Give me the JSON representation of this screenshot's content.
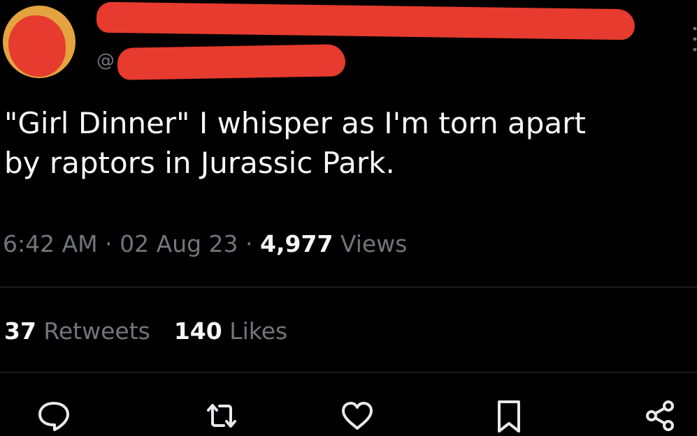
{
  "author": {
    "handle_prefix": "@"
  },
  "tweet": {
    "line1": "\"Girl Dinner\" I whisper as I'm torn apart",
    "line2": "by raptors in Jurassic Park.",
    "time": "6:42 AM",
    "sep1": " · ",
    "date": "02 Aug 23",
    "sep2": " · ",
    "views_count": "4,977",
    "views_label": " Views"
  },
  "stats": {
    "retweets_count": "37",
    "retweets_label": " Retweets",
    "likes_count": "140",
    "likes_label": " Likes"
  },
  "actions": [
    {
      "icon": "reply-icon"
    },
    {
      "icon": "retweet-icon"
    },
    {
      "icon": "like-icon"
    },
    {
      "icon": "bookmark-icon"
    },
    {
      "icon": "share-icon"
    }
  ],
  "colors": {
    "background": "#000000",
    "text": "#f7f9f9",
    "secondary": "#71767b",
    "divider": "#2f3336",
    "redaction": "#e63b2e",
    "avatar_ring": "#e3a33f"
  }
}
